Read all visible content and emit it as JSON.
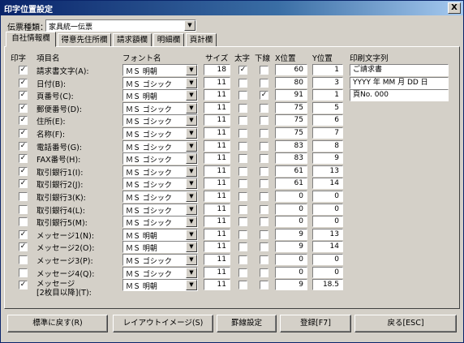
{
  "window": {
    "title": "印字位置設定",
    "close": "X"
  },
  "denpyo": {
    "label": "伝票種類：",
    "selected": "家具統一伝票"
  },
  "tabs": [
    "自社情報欄",
    "得意先住所欄",
    "請求額欄",
    "明細欄",
    "頁計欄"
  ],
  "columns": {
    "print": "印字",
    "item": "項目名",
    "font": "フォント名",
    "size": "サイズ",
    "bold": "太字",
    "underline": "下線",
    "x": "X位置",
    "y": "Y位置",
    "text": "印刷文字列"
  },
  "rows": [
    {
      "print": true,
      "label": "請求書文字(A):",
      "font": "ＭＳ 明朝",
      "size": "18",
      "bold": true,
      "underline": false,
      "x": "60",
      "y": "1"
    },
    {
      "print": true,
      "label": "日付(B):",
      "font": "ＭＳ ゴシック",
      "size": "11",
      "bold": false,
      "underline": false,
      "x": "80",
      "y": "3"
    },
    {
      "print": true,
      "label": "頁番号(C):",
      "font": "ＭＳ 明朝",
      "size": "11",
      "bold": false,
      "underline": true,
      "x": "91",
      "y": "1"
    },
    {
      "print": true,
      "label": "郵便番号(D):",
      "font": "ＭＳ ゴシック",
      "size": "11",
      "bold": false,
      "underline": false,
      "x": "75",
      "y": "5"
    },
    {
      "print": true,
      "label": "住所(E):",
      "font": "ＭＳ ゴシック",
      "size": "11",
      "bold": false,
      "underline": false,
      "x": "75",
      "y": "6"
    },
    {
      "print": true,
      "label": "名称(F):",
      "font": "ＭＳ ゴシック",
      "size": "11",
      "bold": false,
      "underline": false,
      "x": "75",
      "y": "7"
    },
    {
      "print": true,
      "label": "電話番号(G):",
      "font": "ＭＳ ゴシック",
      "size": "11",
      "bold": false,
      "underline": false,
      "x": "83",
      "y": "8"
    },
    {
      "print": true,
      "label": "FAX番号(H):",
      "font": "ＭＳ ゴシック",
      "size": "11",
      "bold": false,
      "underline": false,
      "x": "83",
      "y": "9"
    },
    {
      "print": true,
      "label": "取引銀行1(I):",
      "font": "ＭＳ ゴシック",
      "size": "11",
      "bold": false,
      "underline": false,
      "x": "61",
      "y": "13"
    },
    {
      "print": true,
      "label": "取引銀行2(J):",
      "font": "ＭＳ ゴシック",
      "size": "11",
      "bold": false,
      "underline": false,
      "x": "61",
      "y": "14"
    },
    {
      "print": false,
      "label": "取引銀行3(K):",
      "font": "ＭＳ ゴシック",
      "size": "11",
      "bold": false,
      "underline": false,
      "x": "0",
      "y": "0"
    },
    {
      "print": false,
      "label": "取引銀行4(L):",
      "font": "ＭＳ ゴシック",
      "size": "11",
      "bold": false,
      "underline": false,
      "x": "0",
      "y": "0"
    },
    {
      "print": false,
      "label": "取引銀行5(M):",
      "font": "ＭＳ ゴシック",
      "size": "11",
      "bold": false,
      "underline": false,
      "x": "0",
      "y": "0"
    },
    {
      "print": true,
      "label": "メッセージ1(N):",
      "font": "ＭＳ 明朝",
      "size": "11",
      "bold": false,
      "underline": false,
      "x": "9",
      "y": "13"
    },
    {
      "print": true,
      "label": "メッセージ2(O):",
      "font": "ＭＳ 明朝",
      "size": "11",
      "bold": false,
      "underline": false,
      "x": "9",
      "y": "14"
    },
    {
      "print": false,
      "label": "メッセージ3(P):",
      "font": "ＭＳ ゴシック",
      "size": "11",
      "bold": false,
      "underline": false,
      "x": "0",
      "y": "0"
    },
    {
      "print": false,
      "label": "メッセージ4(Q):",
      "font": "ＭＳ ゴシック",
      "size": "11",
      "bold": false,
      "underline": false,
      "x": "0",
      "y": "0"
    },
    {
      "print": true,
      "label": "メッセージ",
      "label2": "[2枚目以降](T):",
      "font": "ＭＳ 明朝",
      "size": "11",
      "bold": false,
      "underline": false,
      "x": "9",
      "y": "18.5"
    }
  ],
  "print_texts": [
    "ご請求書",
    "YYYY 年 MM 月 DD 日",
    "頁No. 000"
  ],
  "buttons": [
    "標準に戻す(R)",
    "レイアウトイメージ(S)",
    "罫線設定",
    "登録[F7]",
    "戻る[ESC]"
  ]
}
